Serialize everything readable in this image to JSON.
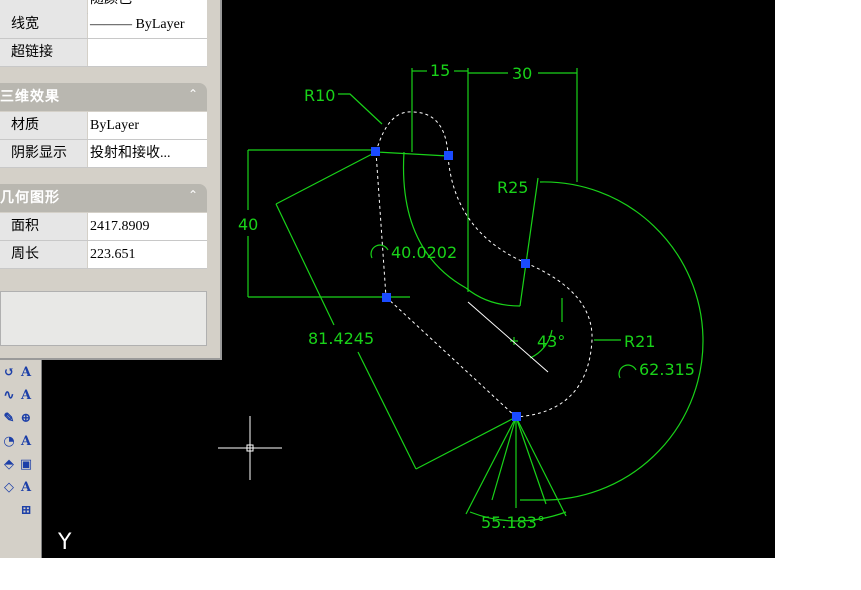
{
  "properties": {
    "partial_row": {
      "label": "",
      "value": "随颜色"
    },
    "lineweight": {
      "label": "线宽",
      "value": "——— ByLayer"
    },
    "hyperlink": {
      "label": "超链接",
      "value": ""
    },
    "section_3d": {
      "title": "三维效果",
      "collapse": "⌃"
    },
    "material": {
      "label": "材质",
      "value": "ByLayer"
    },
    "shadow": {
      "label": "阴影显示",
      "value": "投射和接收..."
    },
    "section_geometry": {
      "title": "几何图形",
      "collapse": "⌃"
    },
    "area": {
      "label": "面积",
      "value": "2417.8909"
    },
    "perimeter": {
      "label": "周长",
      "value": "223.651"
    }
  },
  "drawing": {
    "dims": {
      "r10": "R10",
      "d15": "15",
      "d30": "30",
      "r25": "R25",
      "d40": "40",
      "arc40": "40.0202",
      "ang43": "43°",
      "r21": "R21",
      "len81": "81.4245",
      "arc62": "62.315",
      "ang55": "55.183°"
    },
    "ucs_axis": "Y",
    "colors": {
      "geometry": "#19d219",
      "selection": "#ffffff",
      "grip": "#1a4bff",
      "background": "#000000"
    }
  },
  "toolbar": {
    "icons": [
      "arc-icon",
      "text-icon",
      "spline-icon",
      "text-edit-icon",
      "pencil-icon",
      "find-text-icon",
      "paint-icon",
      "text-style-icon",
      "eraser-icon",
      "attribute-icon",
      "measure-icon",
      "text-frame-icon",
      "block-icon"
    ]
  }
}
